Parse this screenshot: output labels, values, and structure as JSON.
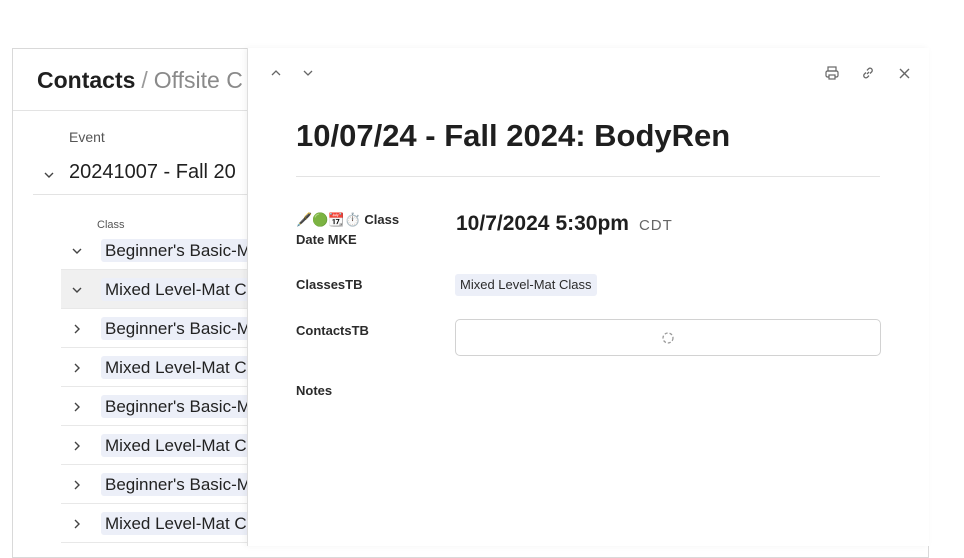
{
  "breadcrumb": {
    "root": "Contacts",
    "separator": "/",
    "current": "Offsite C"
  },
  "list": {
    "group_label": "Event",
    "group_title": "20241007 - Fall 20",
    "sub_label": "Class",
    "rows": [
      {
        "label": "Beginner's Basic-M",
        "expanded": true
      },
      {
        "label": "Mixed Level-Mat C",
        "expanded": true
      },
      {
        "label": "Beginner's Basic-M",
        "expanded": false
      },
      {
        "label": "Mixed Level-Mat C",
        "expanded": false
      },
      {
        "label": "Beginner's Basic-M",
        "expanded": false
      },
      {
        "label": "Mixed Level-Mat C",
        "expanded": false
      },
      {
        "label": "Beginner's Basic-M",
        "expanded": false
      },
      {
        "label": "Mixed Level-Mat C",
        "expanded": false
      }
    ]
  },
  "panel": {
    "icons": {
      "prev": "chevron-up-icon",
      "next": "chevron-down-icon",
      "print": "printer-icon",
      "link": "link-icon",
      "close": "close-icon"
    },
    "title": "10/07/24 - Fall 2024: BodyRen",
    "fields": {
      "date_label_emoji": "🖋️🟢📆⏱️",
      "date_label_text": "Class Date MKE",
      "date_value": "10/7/2024",
      "time_value": "5:30pm",
      "timezone": "CDT",
      "classes_label": "ClassesTB",
      "classes_tag": "Mixed Level-Mat Class",
      "contacts_label": "ContactsTB",
      "notes_label": "Notes"
    }
  },
  "colors": {
    "tag_bg": "#eceff8",
    "border": "#d9d9d9",
    "selected_row": "#f0f0f0"
  }
}
